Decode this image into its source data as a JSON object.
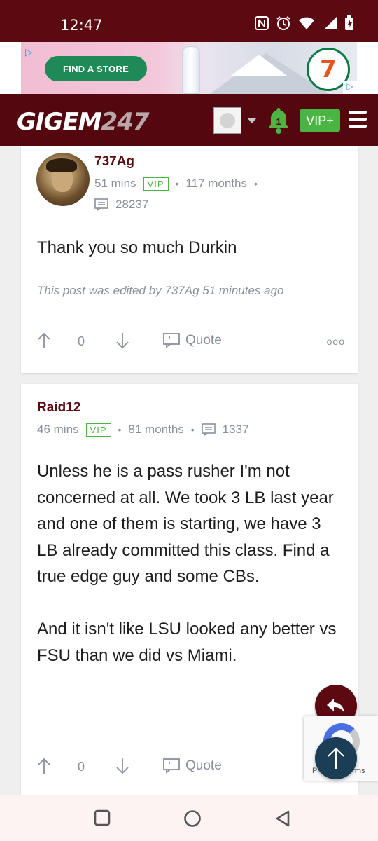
{
  "status_bar": {
    "time": "12:47"
  },
  "ad": {
    "button_label": "FIND A STORE",
    "brand": "ELEVEn"
  },
  "header": {
    "logo_main": "GIGEM",
    "logo_num": "247",
    "notification_count": "1",
    "vip_label": "VIP+"
  },
  "posts": [
    {
      "username": "737Ag",
      "time": "51 mins",
      "badge": "VIP",
      "tenure": "117 months",
      "post_count": "28237",
      "body": "Thank you so much Durkin",
      "edit_note": "This post was edited by 737Ag 51 minutes ago",
      "votes": "0",
      "quote_label": "Quote",
      "more_label": "ooo"
    },
    {
      "username": "Raid12",
      "time": "46 mins",
      "badge": "VIP",
      "tenure": "81 months",
      "post_count": "1337",
      "body": "Unless he is a pass rusher I'm not concerned at all. We took 3 LB last year and one of them is starting, we have 3 LB already committed this class. Find a true edge guy and some CBs.\n\nAnd it isn't like LSU looked any better vs FSU than we did vs Miami.",
      "votes": "0",
      "quote_label": "Quote"
    }
  ],
  "recaptcha": {
    "text": "Privacy - Terms"
  },
  "colors": {
    "brand": "#55070f",
    "vip_green": "#4bb543",
    "meta_gray": "#8a8f9c",
    "fab_top": "#1b3d56"
  }
}
